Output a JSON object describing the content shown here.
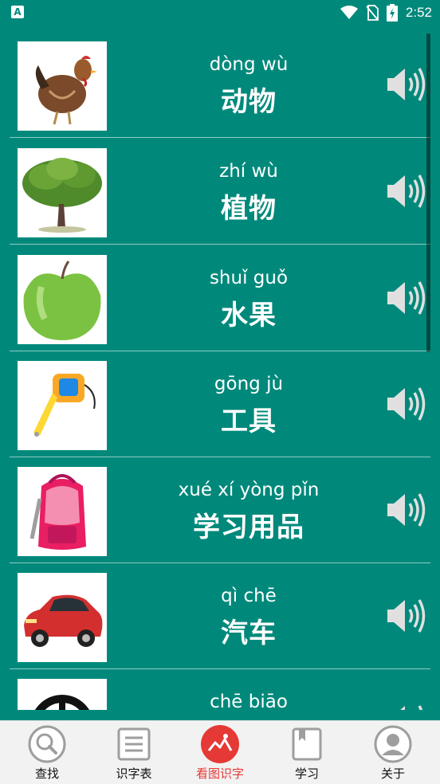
{
  "status": {
    "time": "2:52",
    "app_badge": "A"
  },
  "colors": {
    "background": "#00897b",
    "active_tab": "#e53935",
    "nav_bg": "#f2f2f2"
  },
  "items": [
    {
      "pinyin": "dòng wù",
      "hanzi": "动物",
      "image": "chicken"
    },
    {
      "pinyin": "zhí wù",
      "hanzi": "植物",
      "image": "tree"
    },
    {
      "pinyin": "shuǐ guǒ",
      "hanzi": "水果",
      "image": "apple"
    },
    {
      "pinyin": "gōng jù",
      "hanzi": "工具",
      "image": "tape-measure"
    },
    {
      "pinyin": "xué xí yòng pǐn",
      "hanzi": "学习用品",
      "image": "backpack"
    },
    {
      "pinyin": "qì chē",
      "hanzi": "汽车",
      "image": "car"
    },
    {
      "pinyin": "chē biāo",
      "hanzi": "",
      "image": "car-logo"
    }
  ],
  "nav": [
    {
      "label": "查找",
      "icon": "search-icon",
      "active": false
    },
    {
      "label": "识字表",
      "icon": "list-icon",
      "active": false
    },
    {
      "label": "看图识字",
      "icon": "picture-icon",
      "active": true
    },
    {
      "label": "学习",
      "icon": "book-icon",
      "active": false
    },
    {
      "label": "关于",
      "icon": "user-icon",
      "active": false
    }
  ]
}
